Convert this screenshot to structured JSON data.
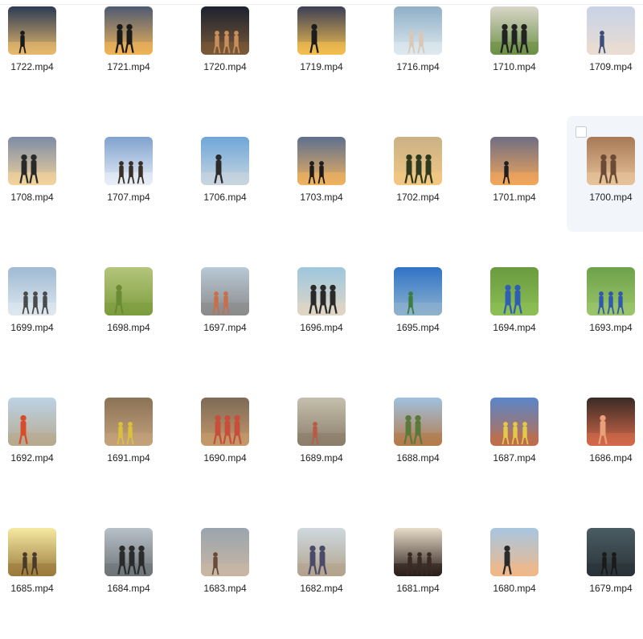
{
  "files": [
    {
      "name": "1722.mp4",
      "icon": "video-thumbnail",
      "bg": [
        "#2c3a55",
        "#e7b96b"
      ],
      "fg": "#1a1a1a",
      "scene": "beach-silhouettes"
    },
    {
      "name": "1721.mp4",
      "icon": "video-thumbnail",
      "bg": [
        "#4d5a73",
        "#f1b457"
      ],
      "fg": "#1b1b1b",
      "scene": "group-silhouettes"
    },
    {
      "name": "1720.mp4",
      "icon": "video-thumbnail",
      "bg": [
        "#1c2130",
        "#7a5a38"
      ],
      "fg": "#c98e5a",
      "scene": "party-sparklers"
    },
    {
      "name": "1719.mp4",
      "icon": "video-thumbnail",
      "bg": [
        "#3b3f55",
        "#f5c04f"
      ],
      "fg": "#1c1c1c",
      "scene": "jump-silhouettes"
    },
    {
      "name": "1716.mp4",
      "icon": "video-thumbnail",
      "bg": [
        "#8fb0c7",
        "#dfe9ef"
      ],
      "fg": "#d9c8b5",
      "scene": "woman-lying"
    },
    {
      "name": "1710.mp4",
      "icon": "video-thumbnail",
      "bg": [
        "#d9d6c9",
        "#6c9146"
      ],
      "fg": "#222222",
      "scene": "lunge-grass"
    },
    {
      "name": "1709.mp4",
      "icon": "video-thumbnail",
      "bg": [
        "#c8d3e6",
        "#e9dcd2"
      ],
      "fg": "#3b4f7a",
      "scene": "woman-sunset"
    },
    {
      "name": "1708.mp4",
      "icon": "video-thumbnail",
      "bg": [
        "#7c8ca6",
        "#f3d39b"
      ],
      "fg": "#2a2a2a",
      "scene": "stretch-field"
    },
    {
      "name": "1707.mp4",
      "icon": "video-thumbnail",
      "bg": [
        "#7fa2cf",
        "#e8eef6"
      ],
      "fg": "#3a2e25",
      "scene": "sky-clouds"
    },
    {
      "name": "1706.mp4",
      "icon": "video-thumbnail",
      "bg": [
        "#6ea6d8",
        "#c9d6de"
      ],
      "fg": "#2b2b2b",
      "scene": "train-city"
    },
    {
      "name": "1703.mp4",
      "icon": "video-thumbnail",
      "bg": [
        "#5d6f8f",
        "#f0b25e"
      ],
      "fg": "#1c1c1c",
      "scene": "group-beach"
    },
    {
      "name": "1702.mp4",
      "icon": "video-thumbnail",
      "bg": [
        "#c9b186",
        "#f3c882"
      ],
      "fg": "#2e3a1f",
      "scene": "sunset-field"
    },
    {
      "name": "1701.mp4",
      "icon": "video-thumbnail",
      "bg": [
        "#6f6e83",
        "#f2a65a"
      ],
      "fg": "#1f1f1f",
      "scene": "man-sunset"
    },
    {
      "name": "1700.mp4",
      "icon": "video-thumbnail",
      "bg": [
        "#a77a55",
        "#e8c39a"
      ],
      "fg": "#6b4a36",
      "scene": "woman-closeup"
    },
    {
      "name": "1699.mp4",
      "icon": "video-thumbnail",
      "bg": [
        "#9fbad3",
        "#dfe8ef"
      ],
      "fg": "#4a4a4a",
      "scene": "walkers-city"
    },
    {
      "name": "1698.mp4",
      "icon": "video-thumbnail",
      "bg": [
        "#b5c57b",
        "#7c9d3e"
      ],
      "fg": "#6a8a36",
      "scene": "grass-field"
    },
    {
      "name": "1697.mp4",
      "icon": "video-thumbnail",
      "bg": [
        "#b9c9d6",
        "#8a8a8a"
      ],
      "fg": "#c96e4a",
      "scene": "palm-street"
    },
    {
      "name": "1696.mp4",
      "icon": "video-thumbnail",
      "bg": [
        "#9ec7de",
        "#e0d6c4"
      ],
      "fg": "#2a2a2a",
      "scene": "beach-runner"
    },
    {
      "name": "1695.mp4",
      "icon": "video-thumbnail",
      "bg": [
        "#2f73c7",
        "#8fb3cd"
      ],
      "fg": "#3d7b3e",
      "scene": "lake-mountains"
    },
    {
      "name": "1694.mp4",
      "icon": "video-thumbnail",
      "bg": [
        "#6a9a3f",
        "#8cbf55"
      ],
      "fg": "#2e5eb5",
      "scene": "stretch-grass"
    },
    {
      "name": "1693.mp4",
      "icon": "video-thumbnail",
      "bg": [
        "#6da24a",
        "#9cc56b"
      ],
      "fg": "#2f58b0",
      "scene": "woman-ball"
    },
    {
      "name": "1692.mp4",
      "icon": "video-thumbnail",
      "bg": [
        "#bcd3e6",
        "#b7a98e"
      ],
      "fg": "#d84b2b",
      "scene": "runner-path"
    },
    {
      "name": "1691.mp4",
      "icon": "video-thumbnail",
      "bg": [
        "#8b7357",
        "#c4a27c"
      ],
      "fg": "#d9c23a",
      "scene": "marathon-crowd"
    },
    {
      "name": "1690.mp4",
      "icon": "video-thumbnail",
      "bg": [
        "#7d6a57",
        "#c59a6a"
      ],
      "fg": "#c84d3a",
      "scene": "marathon-runners"
    },
    {
      "name": "1689.mp4",
      "icon": "video-thumbnail",
      "bg": [
        "#c5c0ad",
        "#8a7d6a"
      ],
      "fg": "#b85a45",
      "scene": "bridge-runners"
    },
    {
      "name": "1688.mp4",
      "icon": "video-thumbnail",
      "bg": [
        "#9fc1df",
        "#b57a4a"
      ],
      "fg": "#5a7a3a",
      "scene": "dry-field"
    },
    {
      "name": "1687.mp4",
      "icon": "video-thumbnail",
      "bg": [
        "#5a86c9",
        "#c06e4a"
      ],
      "fg": "#e2c94a",
      "scene": "city-marathon"
    },
    {
      "name": "1686.mp4",
      "icon": "video-thumbnail",
      "bg": [
        "#3a2a25",
        "#d46a4a"
      ],
      "fg": "#e9a07a",
      "scene": "man-pushup"
    },
    {
      "name": "1685.mp4",
      "icon": "video-thumbnail",
      "bg": [
        "#f5e9a2",
        "#9a7a3c"
      ],
      "fg": "#4a3a2a",
      "scene": "sunrise-runner"
    },
    {
      "name": "1684.mp4",
      "icon": "video-thumbnail",
      "bg": [
        "#b8c0c8",
        "#6d7478"
      ],
      "fg": "#2b2b2b",
      "scene": "waterfront-rail"
    },
    {
      "name": "1683.mp4",
      "icon": "video-thumbnail",
      "bg": [
        "#9aa4ad",
        "#c9b7a4"
      ],
      "fg": "#6b4a3a",
      "scene": "woman-portrait"
    },
    {
      "name": "1682.mp4",
      "icon": "video-thumbnail",
      "bg": [
        "#cfd9df",
        "#b2a38c"
      ],
      "fg": "#4a4a6a",
      "scene": "workout-pier"
    },
    {
      "name": "1681.mp4",
      "icon": "video-thumbnail",
      "bg": [
        "#e8dcc9",
        "#2a1f1a"
      ],
      "fg": "#3a2a22",
      "scene": "stretch-dusk"
    },
    {
      "name": "1680.mp4",
      "icon": "video-thumbnail",
      "bg": [
        "#a7c6e0",
        "#f0b889"
      ],
      "fg": "#2a2a2a",
      "scene": "squat-sunset"
    },
    {
      "name": "1679.mp4",
      "icon": "video-thumbnail",
      "bg": [
        "#4a5d63",
        "#2a3338"
      ],
      "fg": "#1a1a1a",
      "scene": "dark-water"
    }
  ],
  "hover_index": 13
}
